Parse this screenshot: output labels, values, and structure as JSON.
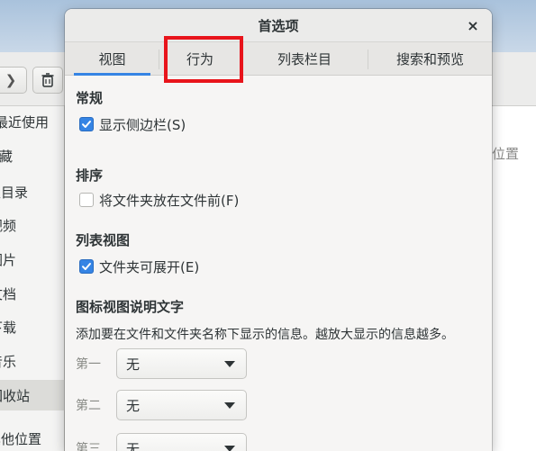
{
  "background": {
    "sidebar_items": [
      "最近使用",
      "收藏",
      "主目录",
      "视频",
      "图片",
      "文档",
      "下载",
      "音乐",
      "回收站",
      "其他位置"
    ],
    "column_header": "位置"
  },
  "dialog": {
    "title": "首选项",
    "close_glyph": "×",
    "tabs": [
      "视图",
      "行为",
      "列表栏目",
      "搜索和预览"
    ],
    "active_tab": "视图",
    "sections": {
      "general": {
        "title": "常规",
        "show_sidebar": {
          "label": "显示侧边栏(S)",
          "checked": true
        }
      },
      "sort": {
        "title": "排序",
        "folders_first": {
          "label": "将文件夹放在文件前(F)",
          "checked": false
        }
      },
      "list_view": {
        "title": "列表视图",
        "expandable_folders": {
          "label": "文件夹可展开(E)",
          "checked": true
        }
      },
      "icon_captions": {
        "title": "图标视图说明文字",
        "description": "添加要在文件和文件夹名称下显示的信息。越放大显示的信息越多。",
        "captions": [
          {
            "label": "第一",
            "value": "无"
          },
          {
            "label": "第二",
            "value": "无"
          },
          {
            "label": "第三",
            "value": "无"
          }
        ]
      }
    }
  },
  "colors": {
    "accent": "#3584e4",
    "highlight_box": "#e8141b"
  }
}
